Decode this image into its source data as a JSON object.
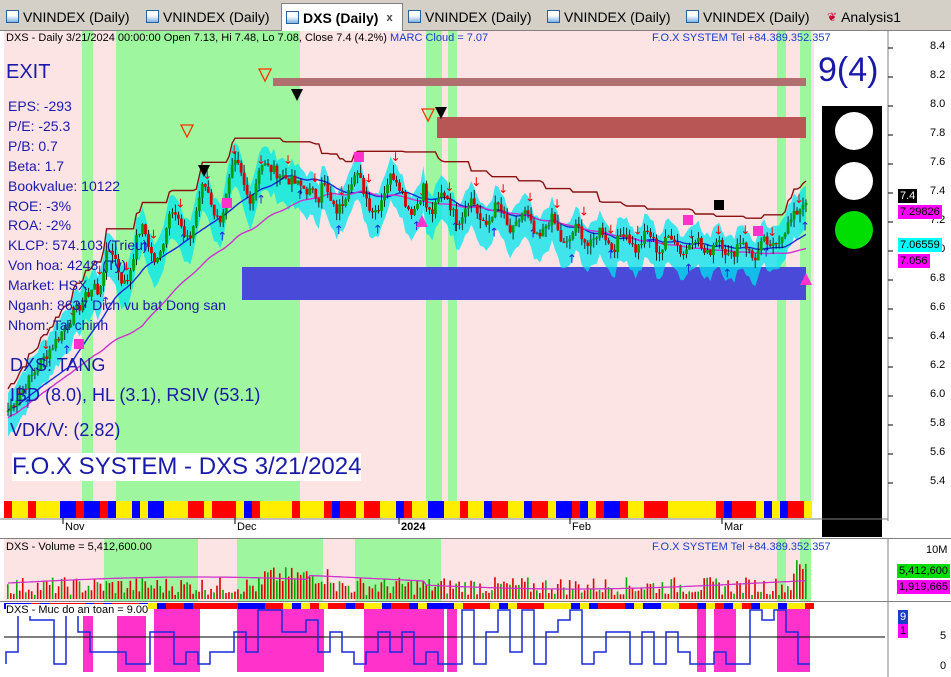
{
  "tabs": [
    {
      "label": "VNINDEX (Daily)",
      "active": false
    },
    {
      "label": "VNINDEX (Daily)",
      "active": false
    },
    {
      "label": "DXS (Daily)",
      "active": true,
      "close": "x"
    },
    {
      "label": "VNINDEX (Daily)",
      "active": false
    },
    {
      "label": "VNINDEX (Daily)",
      "active": false
    },
    {
      "label": "VNINDEX (Daily)",
      "active": false
    },
    {
      "label": "Analysis1",
      "active": false
    }
  ],
  "price_pane": {
    "header": "DXS - Daily 3/21/2024 00:00:00 Open 7.13, Hi 7.48, Lo 7.08, Close 7.4 (4.2%)",
    "marc": "MARC Cloud = 7.07",
    "brand": "F.O.X SYSTEM Tel +84.389.352.357",
    "exit_label": "EXIT",
    "fundamentals": [
      "EPS: -293",
      "P/E: -25.3",
      "P/B: 0.7",
      "Beta: 1.7",
      "Bookvalue: 10122",
      "ROE: -3%",
      "ROA: -2%",
      "KLCP: 574.103 (Trieu)",
      "Von hoa: 4248 (Ty)",
      "Market: HSX",
      "Nganh: 8637 Dich vu bat Dong san",
      "Nhom: Tai chinh"
    ],
    "trend": "DXS: TANG",
    "ibd": "IBD (8.0), HL (3.1), RSIV (53.1)",
    "vdk": "VDK/V:  (2.82)",
    "footer_title": "F.O.X SYSTEM - DXS 3/21/2024",
    "signal_count": "9(4)",
    "y_ticks": [
      "8.4",
      "8.2",
      "8.0",
      "7.8",
      "7.6",
      "7.4",
      "7.2",
      "7.0",
      "6.8",
      "6.6",
      "6.4",
      "6.2",
      "6.0",
      "5.8",
      "5.6",
      "5.4"
    ],
    "x_ticks": [
      "Nov",
      "Dec",
      "2024",
      "Feb",
      "Mar"
    ],
    "price_tags": [
      {
        "text": "7.4",
        "bg": "#000000",
        "fg": "#ffffff"
      },
      {
        "text": "7.29826",
        "bg": "#ff00ff",
        "fg": "#000000"
      },
      {
        "text": "7.06559",
        "bg": "#00ffff",
        "fg": "#000000"
      },
      {
        "text": "7.056",
        "bg": "#ff00ff",
        "fg": "#000000"
      }
    ],
    "light": {
      "top": "white",
      "mid": "white",
      "bottom": "green"
    }
  },
  "volume_pane": {
    "header": "DXS - Volume = 5,412,600.00",
    "brand": "F.O.X SYSTEM Tel +84.389.352.357",
    "y_ticks": [
      "10M"
    ],
    "tags": [
      {
        "text": "5,412,600",
        "bg": "#00dd00",
        "fg": "#000000"
      },
      {
        "text": "1,919,665",
        "bg": "#ff00ff",
        "fg": "#000000"
      }
    ]
  },
  "safety_pane": {
    "header": "DXS - Muc do an toan = 9.00",
    "y_ticks": [
      "5",
      "0"
    ],
    "tags": [
      {
        "text": "9",
        "bg": "#1a3cc8",
        "fg": "#ffffff"
      },
      {
        "text": "1",
        "bg": "#ff00ff",
        "fg": "#000000"
      }
    ]
  },
  "colors": {
    "accent": "#1a1aa8",
    "bull": "#00aa00",
    "bear": "#dd0000",
    "green_zone": "#9ef79e",
    "pink_zone": "#fde4e4"
  }
}
